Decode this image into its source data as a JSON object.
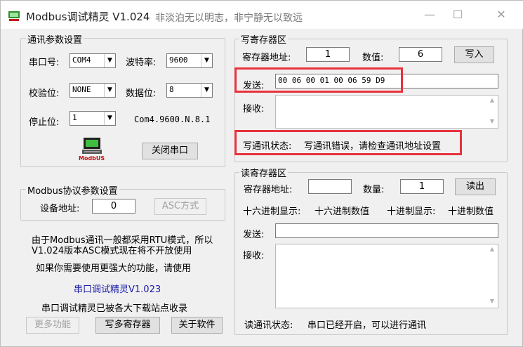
{
  "window": {
    "title": "Modbus调试精灵 V1.024",
    "slogan": "非淡泊无以明志，非宁静无以致远",
    "minimize": "—",
    "maximize": "☐",
    "close": "✕"
  },
  "comm": {
    "group_title": "通讯参数设置",
    "port_label": "串口号:",
    "port_value": "COM4",
    "baud_label": "波特率:",
    "baud_value": "9600",
    "parity_label": "校验位:",
    "parity_value": "NONE",
    "databits_label": "数据位:",
    "databits_value": "8",
    "stopbits_label": "停止位:",
    "stopbits_value": "1",
    "summary": "Com4.9600.N.8.1",
    "modbus_logo": "ModbUS",
    "close_port_button": "关闭串口"
  },
  "protocol": {
    "group_title": "Modbus协议参数设置",
    "device_addr_label": "设备地址:",
    "device_addr_value": "0",
    "asc_button": "ASC方式"
  },
  "info": {
    "line1": "由于Modbus通讯一般都采用RTU模式，所以",
    "line2": "V1.024版本ASC模式现在将不开放使用",
    "line3": "如果你需要使用更强大的功能，请使用",
    "link": "串口调试精灵V1.023",
    "line4": "串口调试精灵已被各大下载站点收录"
  },
  "bottom_buttons": {
    "more": "更多功能",
    "write_multi": "写多寄存器",
    "about": "关于软件"
  },
  "write": {
    "group_title": "写寄存器区",
    "reg_addr_label": "寄存器地址:",
    "reg_addr_value": "1",
    "value_label": "数值:",
    "value_value": "6",
    "write_button": "写入",
    "send_label": "发送:",
    "send_value": "00 06 00 01 00 06 59 D9",
    "recv_label": "接收:",
    "status_label": "写通讯状态:",
    "status_value": "写通讯错误，请检查通讯地址设置"
  },
  "read": {
    "group_title": "读寄存器区",
    "reg_addr_label": "寄存器地址:",
    "reg_addr_value": "",
    "count_label": "数量:",
    "count_value": "1",
    "read_button": "读出",
    "hex_label": "十六进制显示:",
    "hex_value": "十六进制数值",
    "dec_label": "十进制显示:",
    "dec_value": "十进制数值",
    "send_label": "发送:",
    "recv_label": "接收:",
    "status_label": "读通讯状态:",
    "status_value": "串口已经开启，可以进行通讯"
  },
  "colors": {
    "highlight_red": "#e8323c",
    "link_blue": "#1a1aa6"
  }
}
